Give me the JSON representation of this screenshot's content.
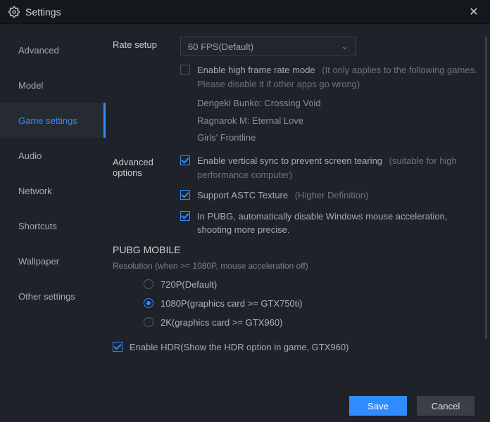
{
  "window": {
    "title": "Settings"
  },
  "sidebar": {
    "items": [
      {
        "label": "Advanced"
      },
      {
        "label": "Model"
      },
      {
        "label": "Game settings"
      },
      {
        "label": "Audio"
      },
      {
        "label": "Network"
      },
      {
        "label": "Shortcuts"
      },
      {
        "label": "Wallpaper"
      },
      {
        "label": "Other settings"
      }
    ],
    "active_index": 2
  },
  "rate": {
    "label": "Rate setup",
    "selected": "60 FPS(Default)",
    "high_frame": {
      "checked": false,
      "text": "Enable high frame rate mode",
      "hint": "(It only applies to the following games. Please disable it if other apps go wrong)",
      "games": [
        "Dengeki Bunko: Crossing Void",
        "Ragnarok M: Eternal Love",
        "Girls' Frontline"
      ]
    }
  },
  "advanced": {
    "label": "Advanced options",
    "vsync": {
      "checked": true,
      "text": "Enable vertical sync to prevent screen tearing",
      "hint": "(suitable for high performance computer)"
    },
    "astc": {
      "checked": true,
      "text": "Support ASTC Texture",
      "hint": "(Higher Definition)"
    },
    "pubg_mouse": {
      "checked": true,
      "text": "In PUBG, automatically disable Windows mouse acceleration, shooting more precise."
    }
  },
  "pubg": {
    "title": "PUBG MOBILE",
    "caption": "Resolution (when >= 1080P, mouse acceleration off)",
    "options": [
      {
        "label": "720P(Default)"
      },
      {
        "label": "1080P(graphics card >= GTX750ti)"
      },
      {
        "label": "2K(graphics card >= GTX960)"
      }
    ],
    "selected_index": 1,
    "hdr": {
      "checked": true,
      "text": "Enable HDR(Show the HDR option in game, GTX960)"
    }
  },
  "footer": {
    "save": "Save",
    "cancel": "Cancel"
  }
}
